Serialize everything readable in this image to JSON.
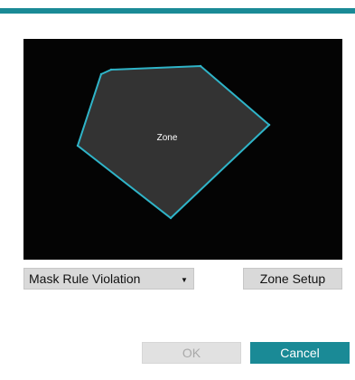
{
  "dialog": {
    "accent_color": "#1a8a96"
  },
  "preview": {
    "background_color": "#040404",
    "zone_fill_color": "#333333",
    "zone_outline_color": "#2fb4c8",
    "zone_label": "Zone"
  },
  "controls": {
    "rule_select": {
      "value": "Mask Rule Violation",
      "caret_icon": "chevron-down-icon"
    },
    "zone_setup_label": "Zone Setup"
  },
  "footer": {
    "ok_label": "OK",
    "ok_enabled": false,
    "cancel_label": "Cancel"
  }
}
